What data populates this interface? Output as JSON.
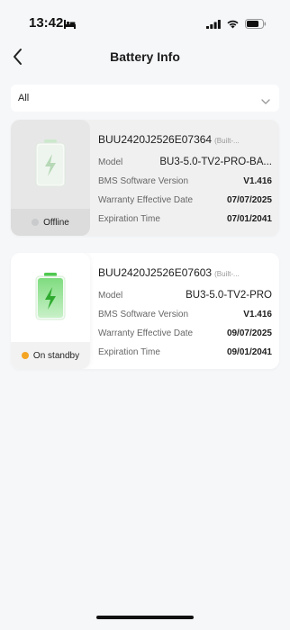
{
  "status_bar": {
    "time": "13:42",
    "icons": [
      "bed-icon",
      "cellular-signal-icon",
      "wifi-icon",
      "battery-icon"
    ]
  },
  "header": {
    "title": "Battery Info",
    "back_icon": "chevron-left-icon"
  },
  "filter": {
    "value": "All",
    "icon": "chevron-down-icon"
  },
  "batteries": [
    {
      "serial": "BUU2420J2526E07364",
      "tag": "(Built-...",
      "status": "Offline",
      "status_color": "#c9cacc",
      "rows": [
        {
          "label": "Model",
          "value": "BU3-5.0-TV2-PRO-BA..."
        },
        {
          "label": "BMS Software Version",
          "value": "V1.416"
        },
        {
          "label": "Warranty Effective Date",
          "value": "07/07/2025"
        },
        {
          "label": "Expiration Time",
          "value": "07/01/2041"
        }
      ]
    },
    {
      "serial": "BUU2420J2526E07603",
      "tag": "(Built-...",
      "status": "On standby",
      "status_color": "#f5a524",
      "rows": [
        {
          "label": "Model",
          "value": "BU3-5.0-TV2-PRO"
        },
        {
          "label": "BMS Software Version",
          "value": "V1.416"
        },
        {
          "label": "Warranty Effective Date",
          "value": "09/07/2025"
        },
        {
          "label": "Expiration Time",
          "value": "09/01/2041"
        }
      ]
    }
  ],
  "colors": {
    "background": "#f6f7f9",
    "battery_green": "#5bd35b",
    "standby": "#f5a524"
  }
}
